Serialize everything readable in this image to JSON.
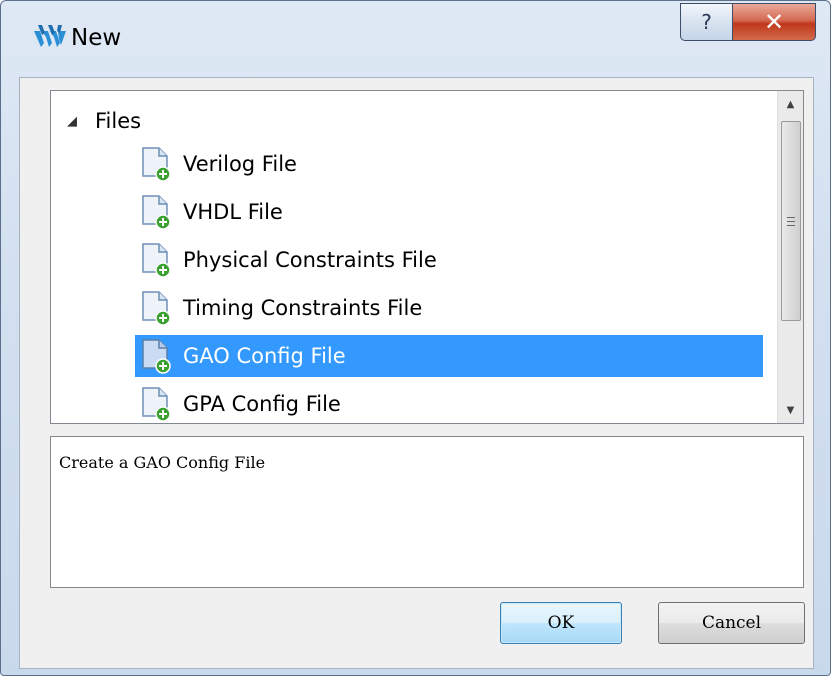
{
  "window": {
    "title": "New",
    "help_glyph": "?",
    "close_glyph": "✕"
  },
  "tree": {
    "root": {
      "expander": "◢",
      "label": "Files"
    },
    "items": [
      {
        "label": "Verilog File",
        "icon": "new-file-icon",
        "selected": false
      },
      {
        "label": "VHDL File",
        "icon": "new-file-icon",
        "selected": false
      },
      {
        "label": "Physical Constraints File",
        "icon": "new-file-icon",
        "selected": false
      },
      {
        "label": "Timing Constraints File",
        "icon": "new-file-icon",
        "selected": false
      },
      {
        "label": "GAO Config File",
        "icon": "new-file-icon",
        "selected": true
      },
      {
        "label": "GPA Config File",
        "icon": "new-file-icon",
        "selected": false
      }
    ],
    "scrollbar": {
      "up": "▲",
      "down": "▼"
    }
  },
  "description": "Create a GAO Config File",
  "buttons": {
    "ok": "OK",
    "cancel": "Cancel"
  },
  "colors": {
    "selection": "#3399ff",
    "close_button": "#c0381d",
    "file_icon_badge": "#3aa02e"
  }
}
